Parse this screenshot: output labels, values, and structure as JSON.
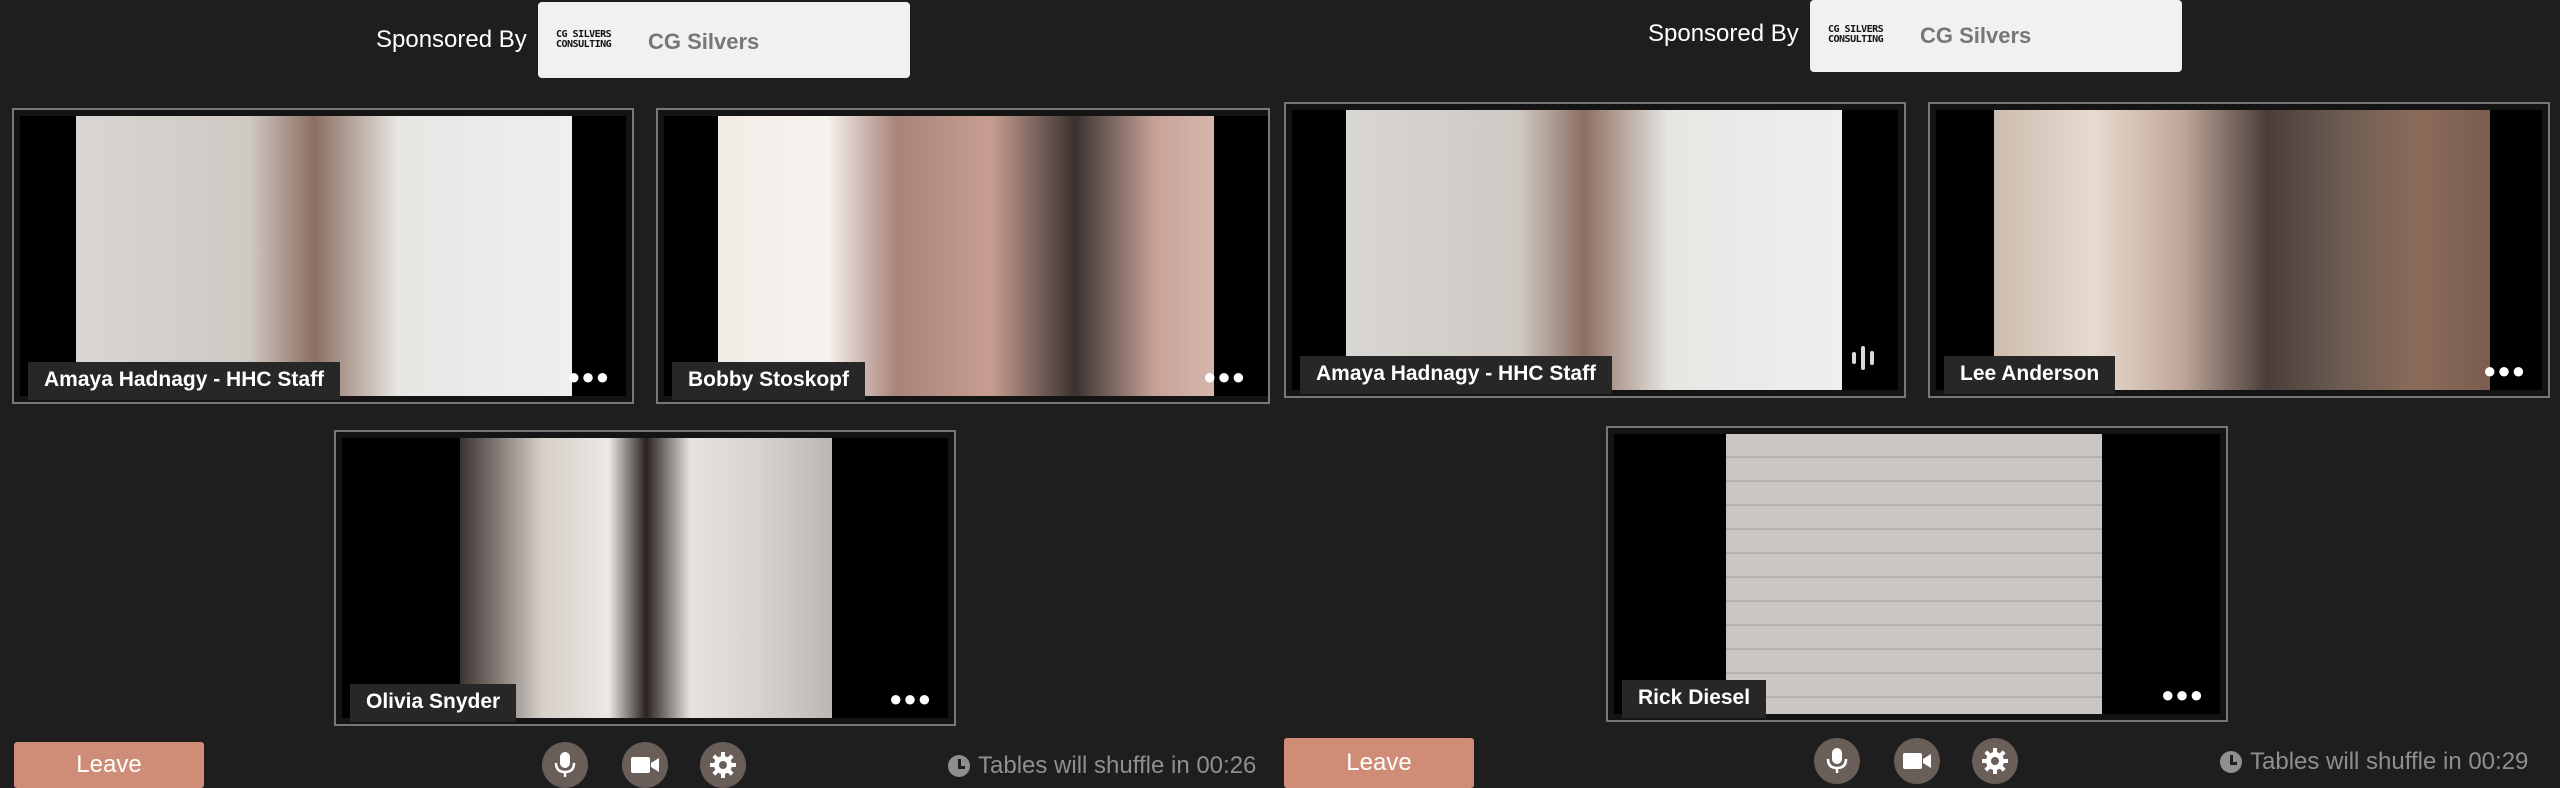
{
  "left_panel": {
    "sponsor": {
      "label": "Sponsored By",
      "logo_text": "CG SILVERS CONSULTING",
      "name": "CG Silvers"
    },
    "participants": [
      {
        "name": "Amaya Hadnagy - HHC Staff"
      },
      {
        "name": "Bobby Stoskopf"
      },
      {
        "name": "Olivia Snyder"
      }
    ],
    "controls": {
      "leave_label": "Leave",
      "shuffle_text": "Tables will shuffle in 00:26"
    }
  },
  "right_panel": {
    "sponsor": {
      "label": "Sponsored By",
      "logo_text": "CG SILVERS CONSULTING",
      "name": "CG Silvers"
    },
    "participants": [
      {
        "name": "Amaya Hadnagy - HHC Staff",
        "speaking": true
      },
      {
        "name": "Lee Anderson"
      },
      {
        "name": "Rick Diesel"
      }
    ],
    "controls": {
      "leave_label": "Leave",
      "shuffle_text": "Tables will shuffle in 00:29"
    }
  },
  "icons": [
    "microphone-icon",
    "camera-icon",
    "gear-icon",
    "clock-icon",
    "more-options-icon",
    "audio-level-icon"
  ],
  "colors": {
    "background": "#1f1e1e",
    "leave_button": "#cf8c76",
    "control_button": "#6a5e58",
    "tile_border": "#777777"
  }
}
